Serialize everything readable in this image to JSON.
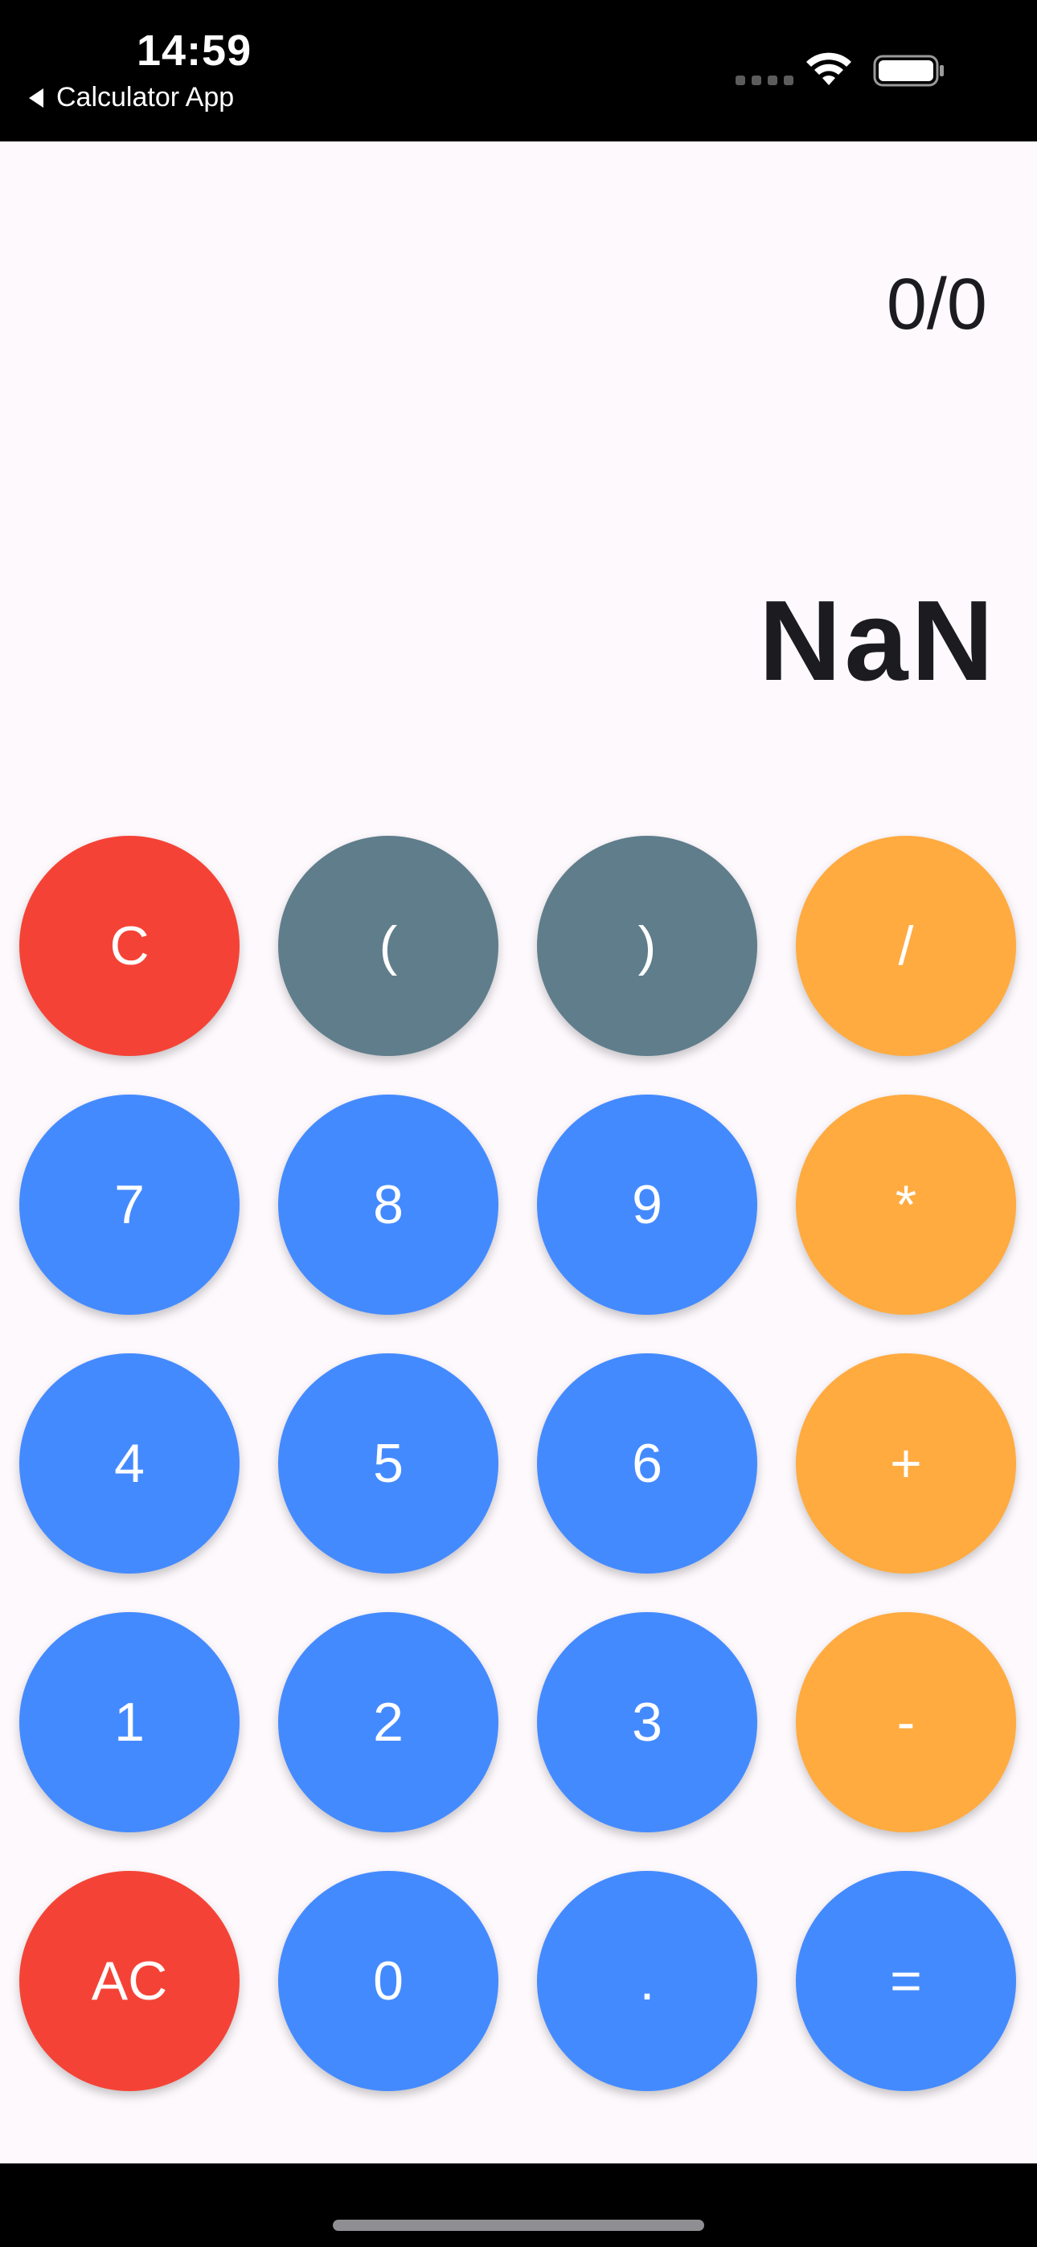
{
  "status_bar": {
    "time": "14:59",
    "back_label": "Calculator App"
  },
  "display": {
    "expression": "0/0",
    "result": "NaN"
  },
  "keypad": {
    "rows": [
      [
        {
          "label": "C",
          "color": "#f44336"
        },
        {
          "label": "(",
          "color": "#607d8b"
        },
        {
          "label": ")",
          "color": "#607d8b"
        },
        {
          "label": "/",
          "color": "#ffab40"
        }
      ],
      [
        {
          "label": "7",
          "color": "#448aff"
        },
        {
          "label": "8",
          "color": "#448aff"
        },
        {
          "label": "9",
          "color": "#448aff"
        },
        {
          "label": "*",
          "color": "#ffab40"
        }
      ],
      [
        {
          "label": "4",
          "color": "#448aff"
        },
        {
          "label": "5",
          "color": "#448aff"
        },
        {
          "label": "6",
          "color": "#448aff"
        },
        {
          "label": "+",
          "color": "#ffab40"
        }
      ],
      [
        {
          "label": "1",
          "color": "#448aff"
        },
        {
          "label": "2",
          "color": "#448aff"
        },
        {
          "label": "3",
          "color": "#448aff"
        },
        {
          "label": "-",
          "color": "#ffab40"
        }
      ],
      [
        {
          "label": "AC",
          "color": "#f44336"
        },
        {
          "label": "0",
          "color": "#448aff"
        },
        {
          "label": ".",
          "color": "#448aff"
        },
        {
          "label": "=",
          "color": "#448aff"
        }
      ]
    ]
  },
  "colors": {
    "background": "#fdf9fd",
    "text": "#1c1b1f",
    "clear": "#f44336",
    "paren": "#607d8b",
    "number": "#448aff",
    "operator": "#ffab40"
  },
  "icons": {
    "back": "back-arrow-icon",
    "signal": "cellular-signal-icon",
    "wifi": "wifi-icon",
    "battery": "battery-icon"
  }
}
